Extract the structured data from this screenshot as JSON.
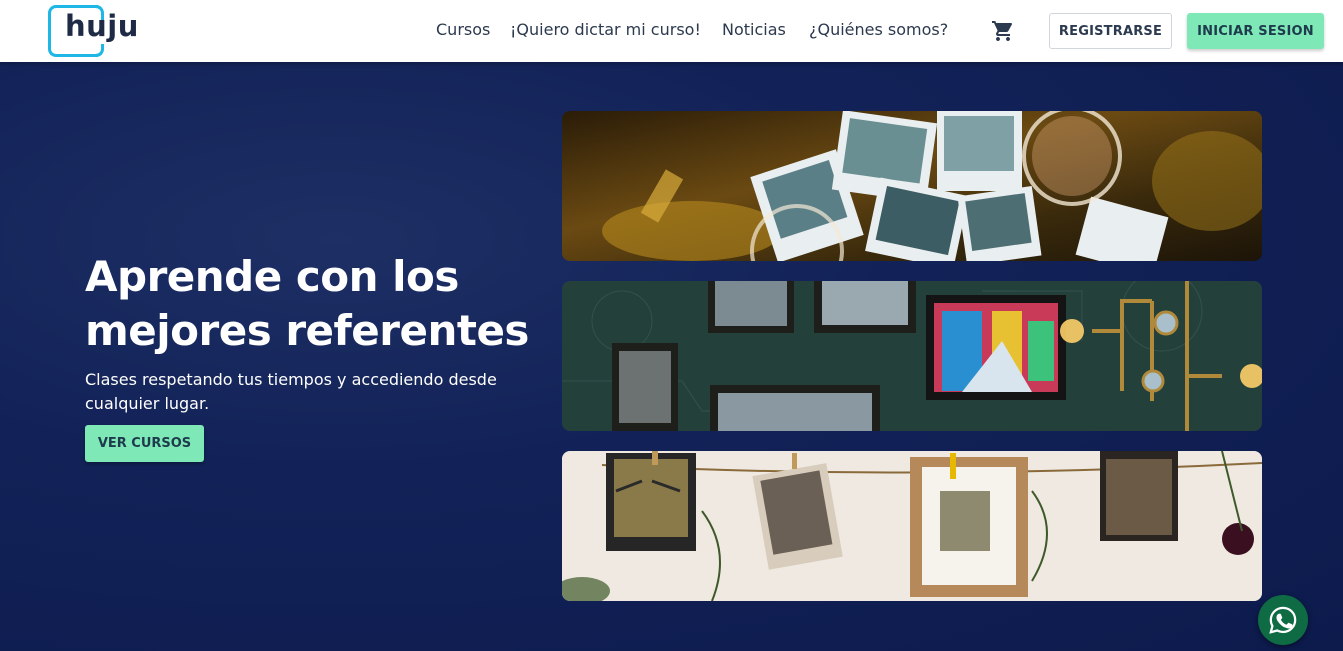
{
  "header": {
    "logo_text": "huju",
    "nav": {
      "courses": "Cursos",
      "teach": "¡Quiero dictar mi curso!",
      "news": "Noticias",
      "about": "¿Quiénes somos?"
    },
    "register_label": "REGISTRARSE",
    "login_label": "INICIAR SESION",
    "cart_icon": "shopping-cart-icon"
  },
  "hero": {
    "title": "Aprende con los mejores referentes",
    "subtitle": "Clases respetando tus tiempos y accediendo desde cualquier lugar.",
    "cta_label": "VER CURSOS",
    "banners": [
      {
        "name": "photography-banner",
        "description_icon": "polaroid-photos"
      },
      {
        "name": "architecture-banner",
        "description_icon": "framed-pictures"
      },
      {
        "name": "art-banner",
        "description_icon": "hanging-prints"
      }
    ]
  },
  "floating": {
    "whatsapp_icon": "whatsapp-icon"
  },
  "colors": {
    "accent": "#7ee8b7",
    "hero_bg": "#122258",
    "logo_blue": "#1fb8e6"
  }
}
